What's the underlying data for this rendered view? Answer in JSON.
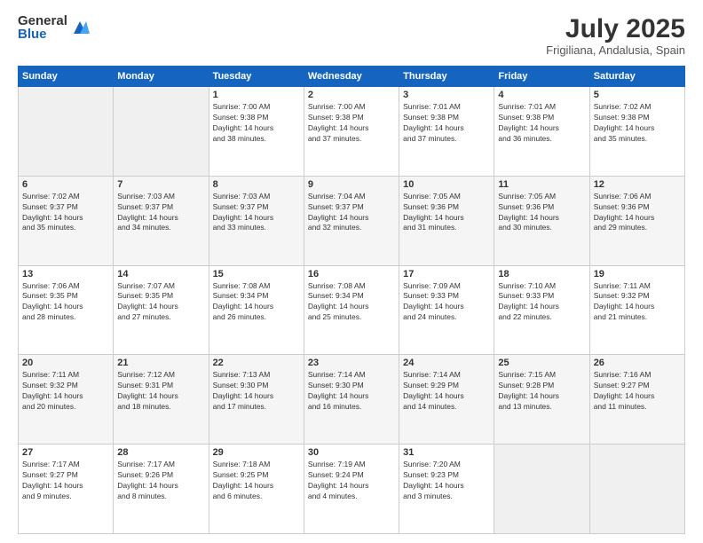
{
  "header": {
    "logo_general": "General",
    "logo_blue": "Blue",
    "month_year": "July 2025",
    "location": "Frigiliana, Andalusia, Spain"
  },
  "days_of_week": [
    "Sunday",
    "Monday",
    "Tuesday",
    "Wednesday",
    "Thursday",
    "Friday",
    "Saturday"
  ],
  "weeks": [
    [
      {
        "day": "",
        "sunrise": "",
        "sunset": "",
        "daylight": ""
      },
      {
        "day": "",
        "sunrise": "",
        "sunset": "",
        "daylight": ""
      },
      {
        "day": "1",
        "sunrise": "Sunrise: 7:00 AM",
        "sunset": "Sunset: 9:38 PM",
        "daylight": "Daylight: 14 hours and 38 minutes."
      },
      {
        "day": "2",
        "sunrise": "Sunrise: 7:00 AM",
        "sunset": "Sunset: 9:38 PM",
        "daylight": "Daylight: 14 hours and 37 minutes."
      },
      {
        "day": "3",
        "sunrise": "Sunrise: 7:01 AM",
        "sunset": "Sunset: 9:38 PM",
        "daylight": "Daylight: 14 hours and 37 minutes."
      },
      {
        "day": "4",
        "sunrise": "Sunrise: 7:01 AM",
        "sunset": "Sunset: 9:38 PM",
        "daylight": "Daylight: 14 hours and 36 minutes."
      },
      {
        "day": "5",
        "sunrise": "Sunrise: 7:02 AM",
        "sunset": "Sunset: 9:38 PM",
        "daylight": "Daylight: 14 hours and 35 minutes."
      }
    ],
    [
      {
        "day": "6",
        "sunrise": "Sunrise: 7:02 AM",
        "sunset": "Sunset: 9:37 PM",
        "daylight": "Daylight: 14 hours and 35 minutes."
      },
      {
        "day": "7",
        "sunrise": "Sunrise: 7:03 AM",
        "sunset": "Sunset: 9:37 PM",
        "daylight": "Daylight: 14 hours and 34 minutes."
      },
      {
        "day": "8",
        "sunrise": "Sunrise: 7:03 AM",
        "sunset": "Sunset: 9:37 PM",
        "daylight": "Daylight: 14 hours and 33 minutes."
      },
      {
        "day": "9",
        "sunrise": "Sunrise: 7:04 AM",
        "sunset": "Sunset: 9:37 PM",
        "daylight": "Daylight: 14 hours and 32 minutes."
      },
      {
        "day": "10",
        "sunrise": "Sunrise: 7:05 AM",
        "sunset": "Sunset: 9:36 PM",
        "daylight": "Daylight: 14 hours and 31 minutes."
      },
      {
        "day": "11",
        "sunrise": "Sunrise: 7:05 AM",
        "sunset": "Sunset: 9:36 PM",
        "daylight": "Daylight: 14 hours and 30 minutes."
      },
      {
        "day": "12",
        "sunrise": "Sunrise: 7:06 AM",
        "sunset": "Sunset: 9:36 PM",
        "daylight": "Daylight: 14 hours and 29 minutes."
      }
    ],
    [
      {
        "day": "13",
        "sunrise": "Sunrise: 7:06 AM",
        "sunset": "Sunset: 9:35 PM",
        "daylight": "Daylight: 14 hours and 28 minutes."
      },
      {
        "day": "14",
        "sunrise": "Sunrise: 7:07 AM",
        "sunset": "Sunset: 9:35 PM",
        "daylight": "Daylight: 14 hours and 27 minutes."
      },
      {
        "day": "15",
        "sunrise": "Sunrise: 7:08 AM",
        "sunset": "Sunset: 9:34 PM",
        "daylight": "Daylight: 14 hours and 26 minutes."
      },
      {
        "day": "16",
        "sunrise": "Sunrise: 7:08 AM",
        "sunset": "Sunset: 9:34 PM",
        "daylight": "Daylight: 14 hours and 25 minutes."
      },
      {
        "day": "17",
        "sunrise": "Sunrise: 7:09 AM",
        "sunset": "Sunset: 9:33 PM",
        "daylight": "Daylight: 14 hours and 24 minutes."
      },
      {
        "day": "18",
        "sunrise": "Sunrise: 7:10 AM",
        "sunset": "Sunset: 9:33 PM",
        "daylight": "Daylight: 14 hours and 22 minutes."
      },
      {
        "day": "19",
        "sunrise": "Sunrise: 7:11 AM",
        "sunset": "Sunset: 9:32 PM",
        "daylight": "Daylight: 14 hours and 21 minutes."
      }
    ],
    [
      {
        "day": "20",
        "sunrise": "Sunrise: 7:11 AM",
        "sunset": "Sunset: 9:32 PM",
        "daylight": "Daylight: 14 hours and 20 minutes."
      },
      {
        "day": "21",
        "sunrise": "Sunrise: 7:12 AM",
        "sunset": "Sunset: 9:31 PM",
        "daylight": "Daylight: 14 hours and 18 minutes."
      },
      {
        "day": "22",
        "sunrise": "Sunrise: 7:13 AM",
        "sunset": "Sunset: 9:30 PM",
        "daylight": "Daylight: 14 hours and 17 minutes."
      },
      {
        "day": "23",
        "sunrise": "Sunrise: 7:14 AM",
        "sunset": "Sunset: 9:30 PM",
        "daylight": "Daylight: 14 hours and 16 minutes."
      },
      {
        "day": "24",
        "sunrise": "Sunrise: 7:14 AM",
        "sunset": "Sunset: 9:29 PM",
        "daylight": "Daylight: 14 hours and 14 minutes."
      },
      {
        "day": "25",
        "sunrise": "Sunrise: 7:15 AM",
        "sunset": "Sunset: 9:28 PM",
        "daylight": "Daylight: 14 hours and 13 minutes."
      },
      {
        "day": "26",
        "sunrise": "Sunrise: 7:16 AM",
        "sunset": "Sunset: 9:27 PM",
        "daylight": "Daylight: 14 hours and 11 minutes."
      }
    ],
    [
      {
        "day": "27",
        "sunrise": "Sunrise: 7:17 AM",
        "sunset": "Sunset: 9:27 PM",
        "daylight": "Daylight: 14 hours and 9 minutes."
      },
      {
        "day": "28",
        "sunrise": "Sunrise: 7:17 AM",
        "sunset": "Sunset: 9:26 PM",
        "daylight": "Daylight: 14 hours and 8 minutes."
      },
      {
        "day": "29",
        "sunrise": "Sunrise: 7:18 AM",
        "sunset": "Sunset: 9:25 PM",
        "daylight": "Daylight: 14 hours and 6 minutes."
      },
      {
        "day": "30",
        "sunrise": "Sunrise: 7:19 AM",
        "sunset": "Sunset: 9:24 PM",
        "daylight": "Daylight: 14 hours and 4 minutes."
      },
      {
        "day": "31",
        "sunrise": "Sunrise: 7:20 AM",
        "sunset": "Sunset: 9:23 PM",
        "daylight": "Daylight: 14 hours and 3 minutes."
      },
      {
        "day": "",
        "sunrise": "",
        "sunset": "",
        "daylight": ""
      },
      {
        "day": "",
        "sunrise": "",
        "sunset": "",
        "daylight": ""
      }
    ]
  ]
}
